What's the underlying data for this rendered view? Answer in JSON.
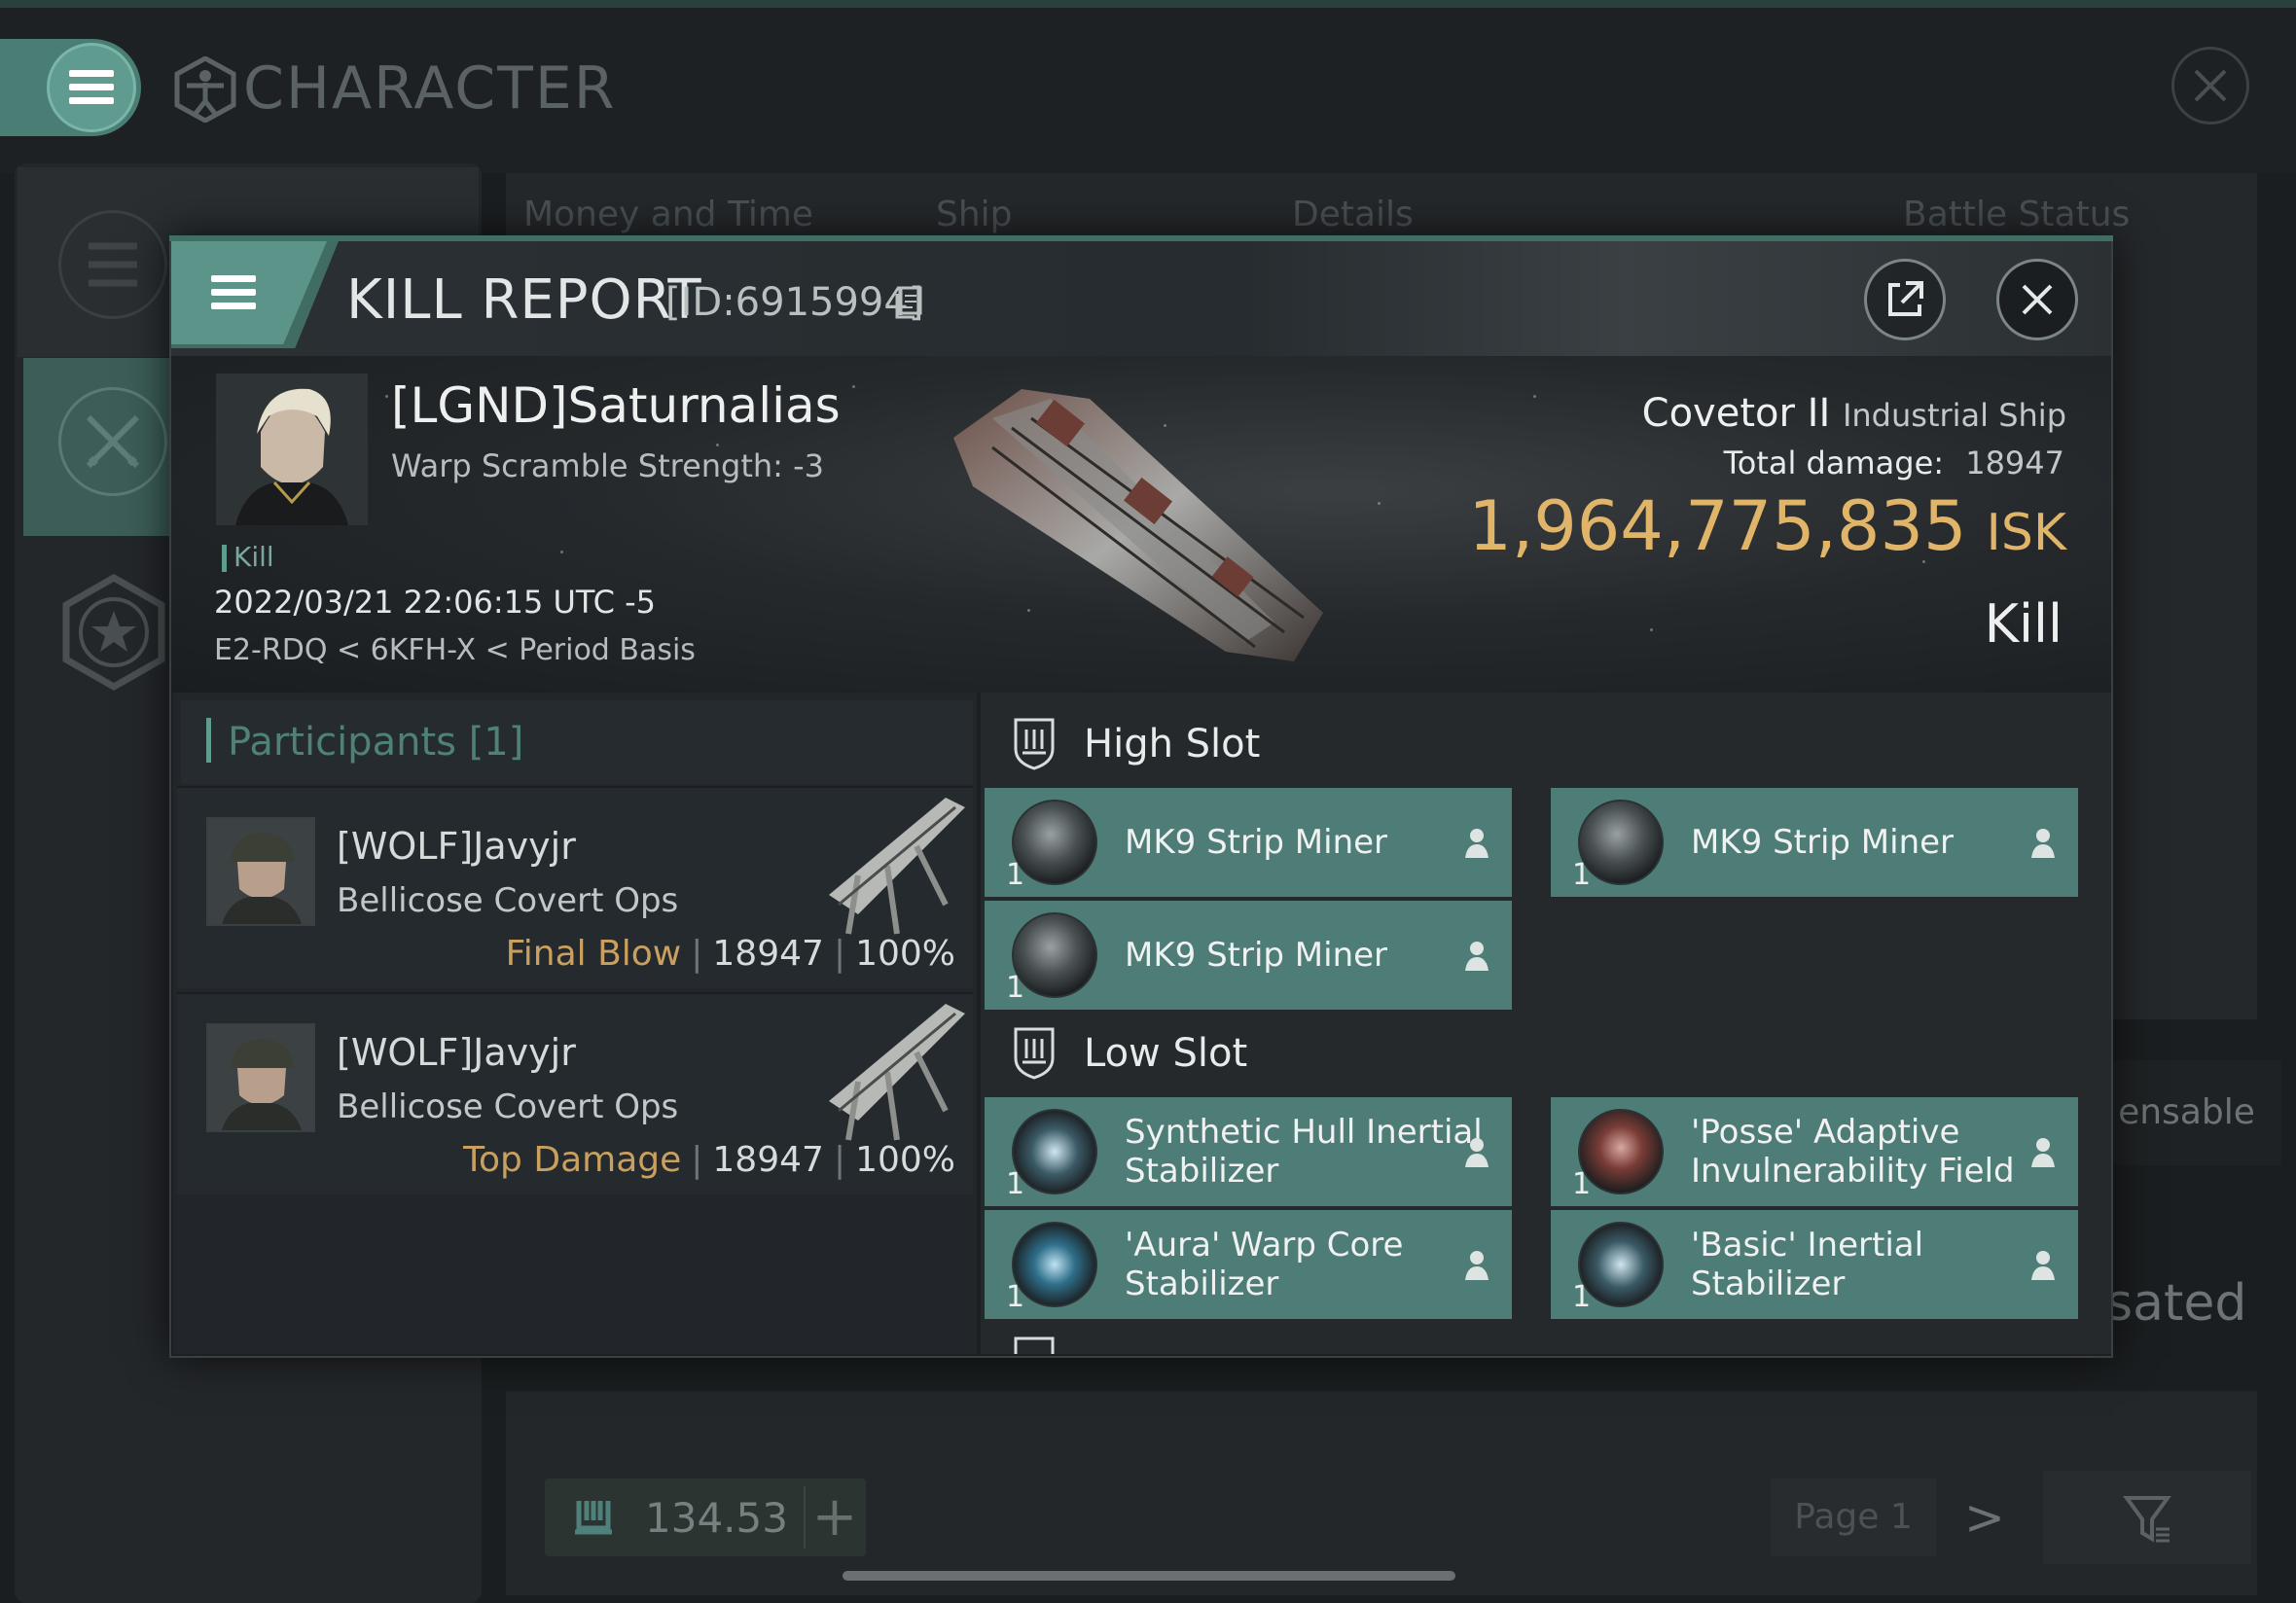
{
  "app": {
    "title": "CHARACTER",
    "icons": {
      "menu": "hamburger-icon",
      "character": "vitruvian-man-icon",
      "close": "close-icon"
    }
  },
  "left_rail": {
    "items": [
      {
        "icon": "list-icon"
      },
      {
        "icon": "crossed-swords-icon",
        "selected": true
      },
      {
        "icon": "star-badge-icon"
      }
    ]
  },
  "background": {
    "tabs": [
      "Money and Time",
      "Ship",
      "Details",
      "Battle Status"
    ],
    "partial_dispensable": "ensable",
    "partial_compensated": "sated",
    "fuel_value": "134.53",
    "plus_label": "+",
    "page_label": "Page 1",
    "next_label": ">"
  },
  "kill_report": {
    "title": "KILL REPORT",
    "id_label": "[ID:6915994]",
    "victim": {
      "name": "[LGND]Saturnalias",
      "warp_scramble": "Warp Scramble Strength: -3",
      "tag": "Kill",
      "datetime": "2022/03/21 22:06:15 UTC -5",
      "location": "E2-RDQ < 6KFH-X < Period Basis"
    },
    "ship": {
      "name": "Covetor II",
      "class": "Industrial Ship",
      "damage_label": "Total damage:",
      "damage_value": "18947",
      "isk_value": "1,964,775,835",
      "isk_unit": "ISK",
      "result": "Kill"
    },
    "participants": {
      "title": "Participants",
      "count": "[1]",
      "rows": [
        {
          "name": "[WOLF]Javyjr",
          "ship": "Bellicose Covert Ops",
          "role": "Final Blow",
          "damage": "18947",
          "percent": "100%"
        },
        {
          "name": "[WOLF]Javyjr",
          "ship": "Bellicose Covert Ops",
          "role": "Top Damage",
          "damage": "18947",
          "percent": "100%"
        }
      ]
    },
    "slots": {
      "high": {
        "label": "High Slot",
        "modules": [
          {
            "qty": "1",
            "name_line1": "MK9 Strip Miner",
            "name_line2": ""
          },
          {
            "qty": "1",
            "name_line1": "MK9 Strip Miner",
            "name_line2": ""
          },
          {
            "qty": "1",
            "name_line1": "MK9 Strip Miner",
            "name_line2": ""
          }
        ]
      },
      "low": {
        "label": "Low Slot",
        "modules": [
          {
            "qty": "1",
            "name_line1": "Synthetic Hull Inertial",
            "name_line2": "Stabilizer"
          },
          {
            "qty": "1",
            "name_line1": "'Posse' Adaptive",
            "name_line2": "Invulnerability Field"
          },
          {
            "qty": "1",
            "name_line1": "'Aura' Warp Core",
            "name_line2": "Stabilizer"
          },
          {
            "qty": "1",
            "name_line1": "'Basic' Inertial",
            "name_line2": "Stabilizer"
          }
        ]
      }
    },
    "colors": {
      "accent": "#5f9b8f",
      "isk": "#e0b56a",
      "role": "#caa05e",
      "module_bg": "#4e7c77"
    }
  }
}
